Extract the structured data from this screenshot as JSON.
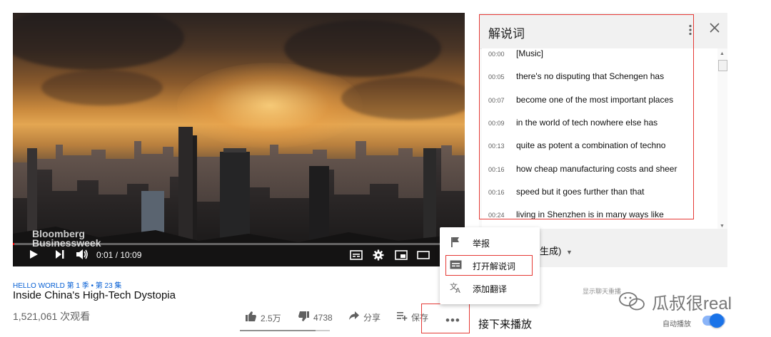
{
  "player": {
    "watermark_line1": "Bloomberg",
    "watermark_line2": "Businessweek",
    "current_time": "0:01 / 10:09",
    "progress_fraction": 0.002,
    "icons": [
      "play-icon",
      "next-icon",
      "volume-icon",
      "subtitles-icon",
      "settings-icon",
      "miniplayer-icon",
      "theater-icon"
    ]
  },
  "transcript": {
    "title": "解说词",
    "language_selector": "生成)",
    "rows": [
      {
        "time": "00:00",
        "text": "[Music]"
      },
      {
        "time": "00:05",
        "text": "there's no disputing that Schengen has"
      },
      {
        "time": "00:07",
        "text": "become one of the most important places"
      },
      {
        "time": "00:09",
        "text": "in the world of tech nowhere else has"
      },
      {
        "time": "00:13",
        "text": "quite as potent a combination of techno"
      },
      {
        "time": "00:16",
        "text": "how cheap manufacturing costs and sheer"
      },
      {
        "time": "00:16",
        "text": "speed but it goes further than that"
      },
      {
        "time": "00:24",
        "text": "living in Shenzhen is in many ways like"
      }
    ]
  },
  "video_info": {
    "tags": "HELLO WORLD 第 1 季 • 第 23 集",
    "title": "Inside China's High-Tech Dystopia",
    "views": "1,521,061 次观看"
  },
  "actions": {
    "like_count": "2.5万",
    "dislike_count": "4738",
    "share_label": "分享",
    "save_label": "保存",
    "more_label": "•••",
    "like_fraction": 0.84
  },
  "menu": {
    "items": [
      {
        "label": "举报",
        "icon": "flag-icon"
      },
      {
        "label": "打开解说词",
        "icon": "transcript-icon"
      },
      {
        "label": "添加翻译",
        "icon": "translate-icon"
      }
    ]
  },
  "sidebar": {
    "live_chat_replay": "显示聊天重播",
    "up_next": "接下来播放",
    "autoplay_label": "自动播放",
    "autoplay_on": true
  },
  "watermark": {
    "text": "瓜叔很real"
  },
  "colors": {
    "highlight": "#e53935",
    "progress": "#ff0000",
    "link": "#065fd4",
    "toggle": "#1a73e8"
  }
}
